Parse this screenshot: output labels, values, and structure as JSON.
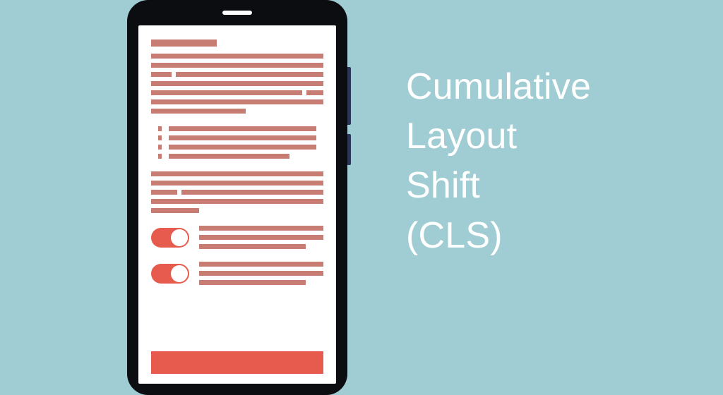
{
  "title_lines": {
    "l1": "Cumulative",
    "l2": "Layout",
    "l3": "Shift",
    "l4": "(CLS)"
  },
  "colors": {
    "background": "#a0cdd4",
    "phone_body": "#0b0d11",
    "content_line": "#c77d74",
    "accent": "#e65b4e",
    "white": "#ffffff",
    "side_button": "#2a3558"
  }
}
